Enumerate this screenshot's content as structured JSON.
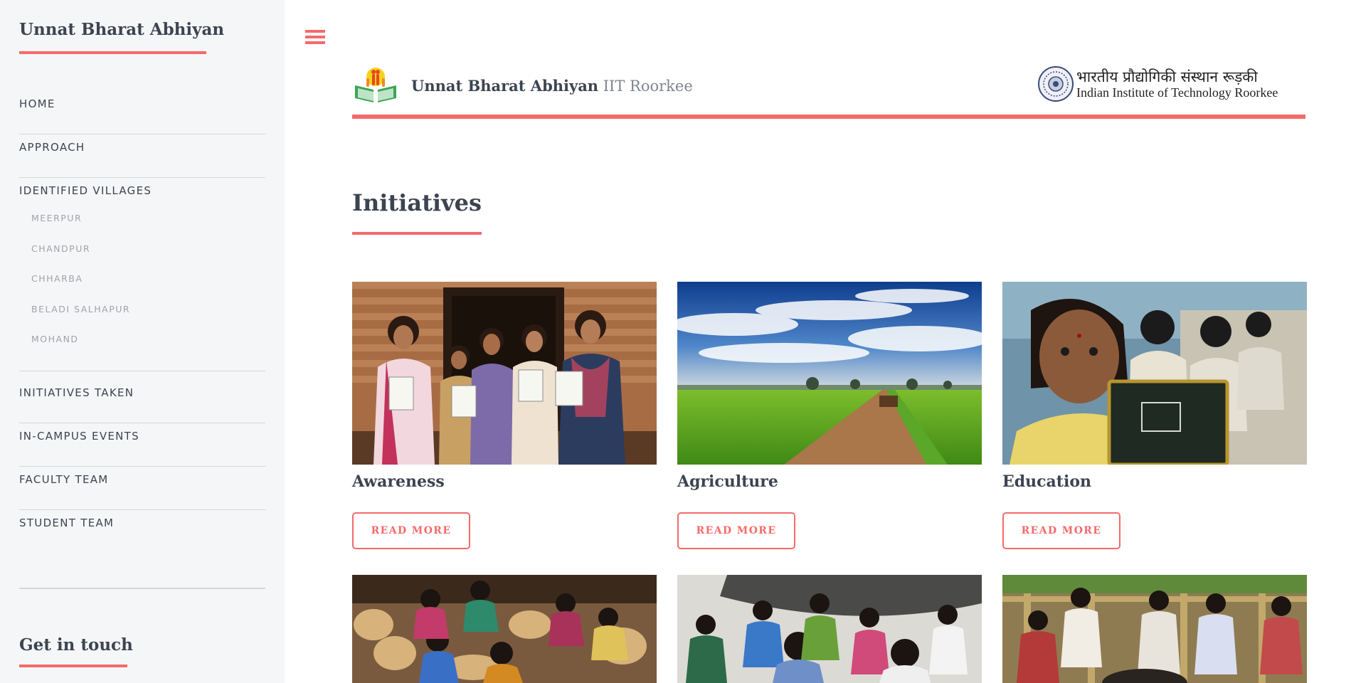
{
  "sidebar": {
    "brand": "Unnat Bharat Abhiyan",
    "nav": [
      {
        "label": "HOME"
      },
      {
        "label": "APPROACH"
      },
      {
        "label": "IDENTIFIED VILLAGES"
      },
      {
        "label": "INITIATIVES TAKEN"
      },
      {
        "label": "IN-CAMPUS EVENTS"
      },
      {
        "label": "FACULTY TEAM"
      },
      {
        "label": "STUDENT TEAM"
      }
    ],
    "villages": [
      "MEERPUR",
      "CHANDPUR",
      "CHHARBA",
      "BELADI SALHAPUR",
      "MOHAND"
    ],
    "touch_title": "Get in touch"
  },
  "header": {
    "title_strong": "Unnat Bharat Abhiyan",
    "title_light": "IIT Roorkee",
    "institute_hindi": "भारतीय प्रौद्योगिकी संस्थान रूड़की",
    "institute_english": "Indian Institute of Technology Roorkee"
  },
  "main": {
    "section_title": "Initiatives",
    "cards": [
      {
        "title": "Awareness",
        "button": "READ MORE"
      },
      {
        "title": "Agriculture",
        "button": "READ MORE"
      },
      {
        "title": "Education",
        "button": "READ MORE"
      }
    ]
  },
  "colors": {
    "accent": "#f56a6a",
    "text": "#3d4451",
    "sidebar_bg": "#f5f6f7",
    "muted": "#9fa3a9"
  },
  "icons": {
    "menu": "hamburger-menu-icon",
    "logo": "unnat-bharat-logo",
    "seal": "iitr-seal"
  }
}
